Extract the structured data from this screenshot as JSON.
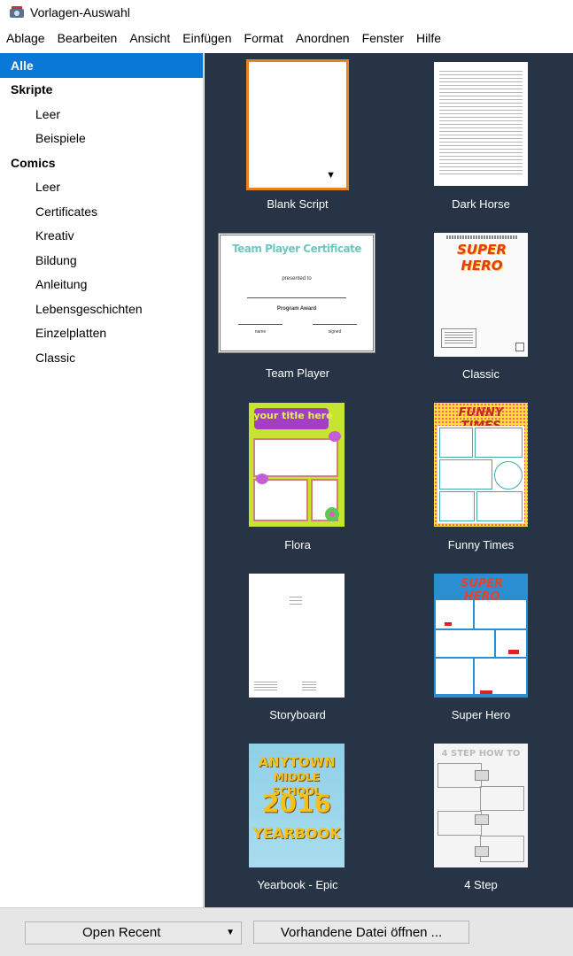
{
  "window": {
    "title": "Vorlagen-Auswahl"
  },
  "menu": [
    "Ablage",
    "Bearbeiten",
    "Ansicht",
    "Einfügen",
    "Format",
    "Anordnen",
    "Fenster",
    "Hilfe"
  ],
  "sidebar": {
    "all": "Alle",
    "scripts_header": "Skripte",
    "script_items": [
      "Leer",
      "Beispiele"
    ],
    "comics_header": "Comics",
    "comic_items": [
      "Leer",
      "Certificates",
      "Kreativ",
      "Bildung",
      "Anleitung",
      "Lebensgeschichten",
      "Einzelplatten",
      "Classic"
    ]
  },
  "templates": [
    {
      "name": "Blank Script"
    },
    {
      "name": "Dark Horse"
    },
    {
      "name": "Team Player",
      "thumb_text": [
        "Team Player Certificate",
        "presented to",
        "Program Award",
        "name",
        "signed"
      ]
    },
    {
      "name": "Classic",
      "thumb_text": [
        "SUPER HERO"
      ]
    },
    {
      "name": "Flora",
      "thumb_text": [
        "your title here"
      ]
    },
    {
      "name": "Funny Times",
      "thumb_text": [
        "FUNNY TIMES"
      ]
    },
    {
      "name": "Storyboard"
    },
    {
      "name": "Super Hero",
      "thumb_text": [
        "SUPER HERO"
      ]
    },
    {
      "name": "Yearbook - Epic",
      "thumb_text": [
        "ANYTOWN",
        "MIDDLE SCHOOL",
        "2016",
        "YEARBOOK"
      ]
    },
    {
      "name": "4 Step",
      "thumb_text": [
        "4 STEP HOW TO"
      ]
    }
  ],
  "buttons": {
    "open_recent": "Open Recent",
    "open_existing": "Vorhandene Datei öffnen ..."
  },
  "colors": {
    "gallery_bg": "#263445",
    "selection_blue": "#0a78d7",
    "selection_orange": "#e8821e"
  }
}
